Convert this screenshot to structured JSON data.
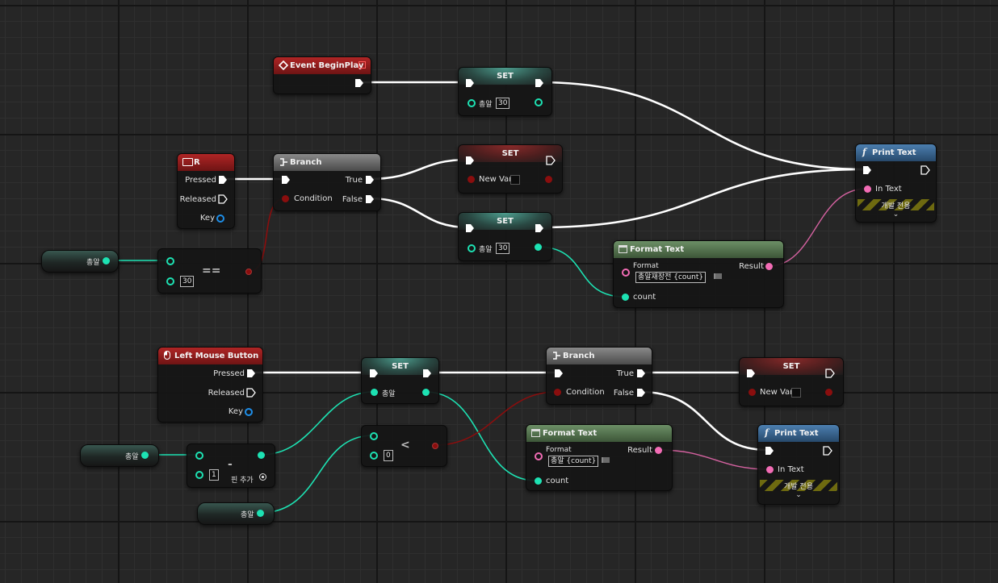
{
  "colors": {
    "exec": "#ffffff",
    "int": "#1de2b3",
    "bool": "#8a0e0e",
    "text": "#f26cb5",
    "struct": "#1e8ee8"
  },
  "event_beginplay": {
    "title": "Event BeginPlay"
  },
  "set1": {
    "title": "SET",
    "var": "총알",
    "value": "30"
  },
  "key_r": {
    "title": "R",
    "pressed": "Pressed",
    "released": "Released",
    "key": "Key"
  },
  "branch1": {
    "title": "Branch",
    "condition": "Condition",
    "true_label": "True",
    "false_label": "False"
  },
  "set_newvar1": {
    "title": "SET",
    "var": "New Var"
  },
  "set2": {
    "title": "SET",
    "var": "총알",
    "value": "30"
  },
  "getter1": {
    "label": "총알"
  },
  "equal1": {
    "op": "==",
    "value": "30"
  },
  "format1": {
    "title": "Format Text",
    "format_label": "Format",
    "format_value": "총알재장전 {count}",
    "result": "Result",
    "count": "count"
  },
  "print1": {
    "title": "Print Text",
    "in_text": "In Text",
    "dev_only": "개발 전용"
  },
  "lmb": {
    "title": "Left Mouse Button",
    "pressed": "Pressed",
    "released": "Released",
    "key": "Key"
  },
  "set3": {
    "title": "SET",
    "var": "총알"
  },
  "branch2": {
    "title": "Branch",
    "condition": "Condition",
    "true_label": "True",
    "false_label": "False"
  },
  "set_newvar2": {
    "title": "SET",
    "var": "New Var"
  },
  "getter2": {
    "label": "총알"
  },
  "getter3": {
    "label": "총알"
  },
  "minus1": {
    "op": "-",
    "value": "1",
    "add_pin": "핀 추가"
  },
  "less1": {
    "op": "<",
    "value": "0"
  },
  "format2": {
    "title": "Format Text",
    "format_label": "Format",
    "format_value": "총알 {count}",
    "result": "Result",
    "count": "count"
  },
  "print2": {
    "title": "Print Text",
    "in_text": "In Text",
    "dev_only": "개발 전용"
  }
}
